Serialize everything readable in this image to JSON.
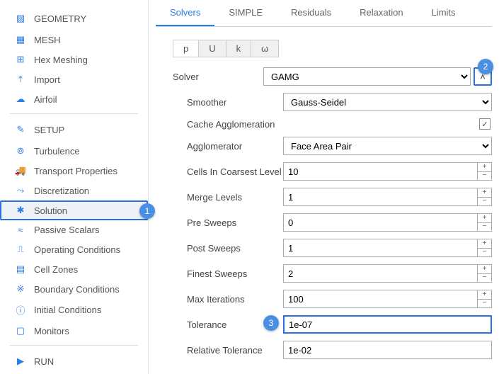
{
  "sidebar": {
    "groups": [
      {
        "label": "GEOMETRY",
        "icon": "▧",
        "items": [
          {
            "label": "MESH",
            "icon": "▦"
          },
          {
            "label": "Hex Meshing",
            "icon": "⊞"
          },
          {
            "label": "Import",
            "icon": "⤒"
          },
          {
            "label": "Airfoil",
            "icon": "☁"
          }
        ]
      },
      {
        "label": "SETUP",
        "icon": "✎",
        "items": [
          {
            "label": "Turbulence",
            "icon": "⊚"
          },
          {
            "label": "Transport Properties",
            "icon": "🚚"
          },
          {
            "label": "Discretization",
            "icon": "⤳"
          },
          {
            "label": "Solution",
            "icon": "✱",
            "selected": true,
            "badge": 1
          },
          {
            "label": "Passive Scalars",
            "icon": "≈"
          },
          {
            "label": "Operating Conditions",
            "icon": "⎍"
          },
          {
            "label": "Cell Zones",
            "icon": "▤"
          },
          {
            "label": "Boundary Conditions",
            "icon": "※"
          },
          {
            "label": "Initial Conditions",
            "icon": "ⓘ"
          },
          {
            "label": "Monitors",
            "icon": "▢"
          }
        ]
      },
      {
        "label": "RUN",
        "icon": "▶",
        "items": []
      }
    ]
  },
  "tabs": [
    "Solvers",
    "SIMPLE",
    "Residuals",
    "Relaxation",
    "Limits"
  ],
  "active_tab": 0,
  "subtabs": [
    "p",
    "U",
    "k",
    "ω"
  ],
  "active_subtab": 0,
  "solver": {
    "label": "Solver",
    "value": "GAMG",
    "expand_badge": 2,
    "params": [
      {
        "label": "Smoother",
        "type": "select",
        "value": "Gauss-Seidel"
      },
      {
        "label": "Cache Agglomeration",
        "type": "check",
        "value": true
      },
      {
        "label": "Agglomerator",
        "type": "select",
        "value": "Face Area Pair"
      },
      {
        "label": "Cells In Coarsest Level",
        "type": "spin",
        "value": "10"
      },
      {
        "label": "Merge Levels",
        "type": "spin",
        "value": "1"
      },
      {
        "label": "Pre Sweeps",
        "type": "spin",
        "value": "0"
      },
      {
        "label": "Post Sweeps",
        "type": "spin",
        "value": "1"
      },
      {
        "label": "Finest Sweeps",
        "type": "spin",
        "value": "2"
      },
      {
        "label": "Max Iterations",
        "type": "spin",
        "value": "100"
      },
      {
        "label": "Tolerance",
        "type": "text",
        "value": "1e-07",
        "badge": 3,
        "highlight": true
      },
      {
        "label": "Relative Tolerance",
        "type": "text",
        "value": "1e-02"
      }
    ]
  }
}
